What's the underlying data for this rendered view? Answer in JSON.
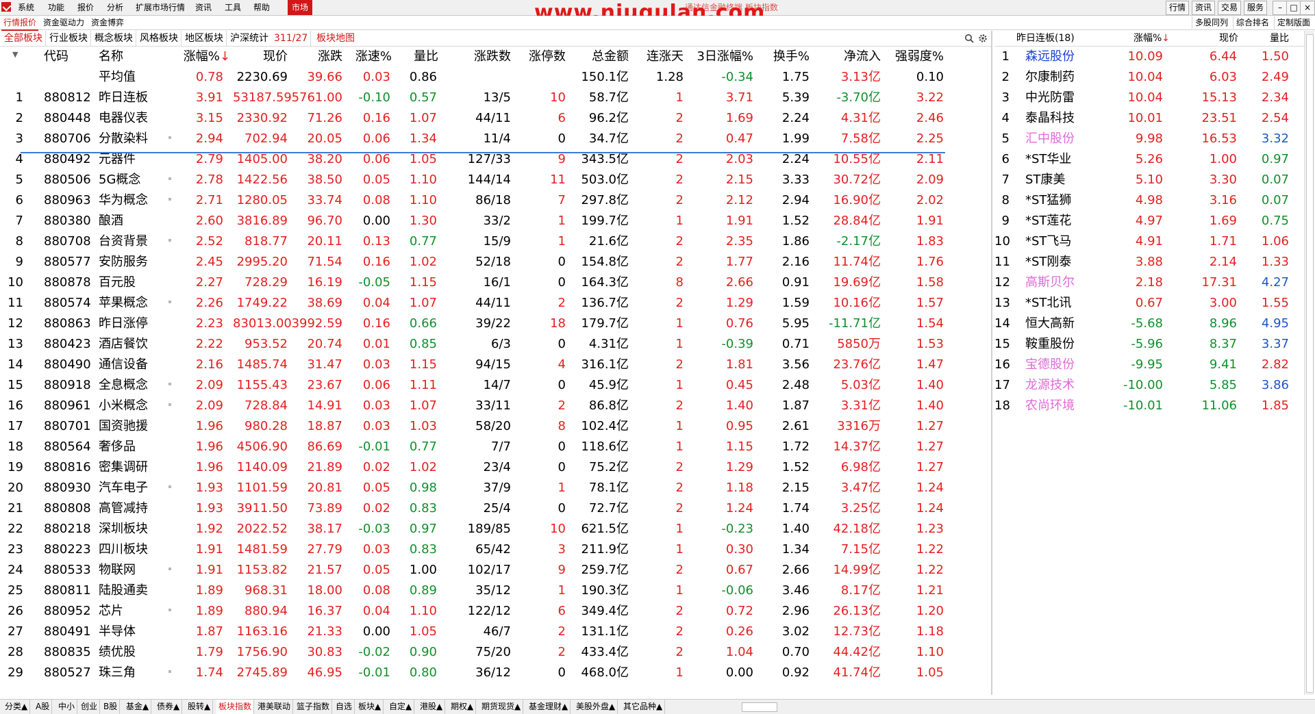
{
  "menubar": {
    "items": [
      "系统",
      "功能",
      "报价",
      "分析",
      "扩展市场行情",
      "资讯",
      "工具",
      "帮助",
      "市场"
    ],
    "watermark": "www.niugulan.com",
    "title_faint": "通达信金融终端  板块指数",
    "right_buttons": [
      "行情",
      "资讯",
      "交易",
      "服务"
    ]
  },
  "subbar": {
    "tabs": [
      "行情报价",
      "资金驱动力",
      "资金博弈"
    ],
    "right": [
      "多股同列",
      "综合排名",
      "定制版面"
    ]
  },
  "tabbar": {
    "tabs": [
      "全部板块",
      "行业板块",
      "概念板块",
      "风格板块",
      "地区板块",
      "沪深统计"
    ],
    "count": "311/27",
    "map": "板块地图"
  },
  "main": {
    "headers": [
      "代码",
      "名称",
      "涨幅%↓",
      "现价",
      "涨跌",
      "涨速%",
      "量比",
      "涨跌数",
      "涨停数",
      "总金额",
      "连涨天",
      "3日涨幅%",
      "换手%",
      "净流入",
      "强弱度%"
    ],
    "avg": {
      "name": "平均值",
      "pct": "0.78",
      "price": "2230.69",
      "chg": "39.66",
      "speed": "0.03",
      "vr": "0.86",
      "amount": "150.1亿",
      "days": "1.28",
      "d3": "-0.34",
      "turn": "1.75",
      "flow": "3.13亿",
      "str": "0.10"
    },
    "rows": [
      {
        "n": "1",
        "code": "880812",
        "name": "昨日连板",
        "dot": false,
        "pct": "3.91",
        "price": "53187.59",
        "chg": "5761.00",
        "speed": "-0.10",
        "vr": "0.57",
        "ud": "13/5",
        "lim": "10",
        "amount": "58.7亿",
        "days": "1",
        "d3": "3.71",
        "turn": "5.39",
        "flow": "-3.70亿",
        "str": "3.22"
      },
      {
        "n": "2",
        "code": "880448",
        "name": "电器仪表",
        "dot": false,
        "pct": "3.15",
        "price": "2330.92",
        "chg": "71.26",
        "speed": "0.16",
        "vr": "1.07",
        "ud": "44/11",
        "lim": "6",
        "amount": "96.2亿",
        "days": "2",
        "d3": "1.69",
        "turn": "2.24",
        "flow": "4.31亿",
        "str": "2.46"
      },
      {
        "n": "3",
        "code": "880706",
        "name": "分散染料",
        "dot": true,
        "pct": "2.94",
        "price": "702.94",
        "chg": "20.05",
        "speed": "0.06",
        "vr": "1.34",
        "ud": "11/4",
        "lim": "0",
        "amount": "34.7亿",
        "days": "2",
        "d3": "0.47",
        "turn": "1.99",
        "flow": "7.58亿",
        "str": "2.25"
      },
      {
        "n": "4",
        "code": "880492",
        "name": "元器件",
        "dot": false,
        "pct": "2.79",
        "price": "1405.00",
        "chg": "38.20",
        "speed": "0.06",
        "vr": "1.05",
        "ud": "127/33",
        "lim": "9",
        "amount": "343.5亿",
        "days": "2",
        "d3": "2.03",
        "turn": "2.24",
        "flow": "10.55亿",
        "str": "2.11"
      },
      {
        "n": "5",
        "code": "880506",
        "name": "5G概念",
        "dot": true,
        "pct": "2.78",
        "price": "1422.56",
        "chg": "38.50",
        "speed": "0.05",
        "vr": "1.10",
        "ud": "144/14",
        "lim": "11",
        "amount": "503.0亿",
        "days": "2",
        "d3": "2.15",
        "turn": "3.33",
        "flow": "30.72亿",
        "str": "2.09"
      },
      {
        "n": "6",
        "code": "880963",
        "name": "华为概念",
        "dot": true,
        "pct": "2.71",
        "price": "1280.05",
        "chg": "33.74",
        "speed": "0.08",
        "vr": "1.10",
        "ud": "86/18",
        "lim": "7",
        "amount": "297.8亿",
        "days": "2",
        "d3": "2.12",
        "turn": "2.94",
        "flow": "16.90亿",
        "str": "2.02"
      },
      {
        "n": "7",
        "code": "880380",
        "name": "酿酒",
        "dot": false,
        "pct": "2.60",
        "price": "3816.89",
        "chg": "96.70",
        "speed": "0.00",
        "vr": "1.30",
        "ud": "33/2",
        "lim": "1",
        "amount": "199.7亿",
        "days": "1",
        "d3": "1.91",
        "turn": "1.52",
        "flow": "28.84亿",
        "str": "1.91"
      },
      {
        "n": "8",
        "code": "880708",
        "name": "台资背景",
        "dot": true,
        "pct": "2.52",
        "price": "818.77",
        "chg": "20.11",
        "speed": "0.13",
        "vr": "0.77",
        "ud": "15/9",
        "lim": "1",
        "amount": "21.6亿",
        "days": "2",
        "d3": "2.35",
        "turn": "1.86",
        "flow": "-2.17亿",
        "str": "1.83"
      },
      {
        "n": "9",
        "code": "880577",
        "name": "安防服务",
        "dot": false,
        "pct": "2.45",
        "price": "2995.20",
        "chg": "71.54",
        "speed": "0.16",
        "vr": "1.02",
        "ud": "52/18",
        "lim": "0",
        "amount": "154.8亿",
        "days": "2",
        "d3": "1.77",
        "turn": "2.16",
        "flow": "11.74亿",
        "str": "1.76"
      },
      {
        "n": "10",
        "code": "880878",
        "name": "百元股",
        "dot": false,
        "pct": "2.27",
        "price": "728.29",
        "chg": "16.19",
        "speed": "-0.05",
        "vr": "1.15",
        "ud": "16/1",
        "lim": "0",
        "amount": "164.3亿",
        "days": "8",
        "d3": "2.66",
        "turn": "0.91",
        "flow": "19.69亿",
        "str": "1.58"
      },
      {
        "n": "11",
        "code": "880574",
        "name": "苹果概念",
        "dot": true,
        "pct": "2.26",
        "price": "1749.22",
        "chg": "38.69",
        "speed": "0.04",
        "vr": "1.07",
        "ud": "44/11",
        "lim": "2",
        "amount": "136.7亿",
        "days": "2",
        "d3": "1.29",
        "turn": "1.59",
        "flow": "10.16亿",
        "str": "1.57"
      },
      {
        "n": "12",
        "code": "880863",
        "name": "昨日涨停",
        "dot": false,
        "pct": "2.23",
        "price": "83013.00",
        "chg": "3992.59",
        "speed": "0.16",
        "vr": "0.66",
        "ud": "39/22",
        "lim": "18",
        "amount": "179.7亿",
        "days": "1",
        "d3": "0.76",
        "turn": "5.95",
        "flow": "-11.71亿",
        "str": "1.54"
      },
      {
        "n": "13",
        "code": "880423",
        "name": "酒店餐饮",
        "dot": false,
        "pct": "2.22",
        "price": "953.52",
        "chg": "20.74",
        "speed": "0.01",
        "vr": "0.85",
        "ud": "6/3",
        "lim": "0",
        "amount": "4.31亿",
        "days": "1",
        "d3": "-0.39",
        "turn": "0.71",
        "flow": "5850万",
        "str": "1.53"
      },
      {
        "n": "14",
        "code": "880490",
        "name": "通信设备",
        "dot": false,
        "pct": "2.16",
        "price": "1485.74",
        "chg": "31.47",
        "speed": "0.03",
        "vr": "1.15",
        "ud": "94/15",
        "lim": "4",
        "amount": "316.1亿",
        "days": "2",
        "d3": "1.81",
        "turn": "3.56",
        "flow": "23.76亿",
        "str": "1.47"
      },
      {
        "n": "15",
        "code": "880918",
        "name": "全息概念",
        "dot": true,
        "pct": "2.09",
        "price": "1155.43",
        "chg": "23.67",
        "speed": "0.06",
        "vr": "1.11",
        "ud": "14/7",
        "lim": "0",
        "amount": "45.9亿",
        "days": "1",
        "d3": "0.45",
        "turn": "2.48",
        "flow": "5.03亿",
        "str": "1.40"
      },
      {
        "n": "16",
        "code": "880961",
        "name": "小米概念",
        "dot": true,
        "pct": "2.09",
        "price": "728.84",
        "chg": "14.91",
        "speed": "0.03",
        "vr": "1.07",
        "ud": "33/11",
        "lim": "2",
        "amount": "86.8亿",
        "days": "2",
        "d3": "1.40",
        "turn": "1.87",
        "flow": "3.31亿",
        "str": "1.40"
      },
      {
        "n": "17",
        "code": "880701",
        "name": "国资驰援",
        "dot": false,
        "pct": "1.96",
        "price": "980.28",
        "chg": "18.87",
        "speed": "0.03",
        "vr": "1.03",
        "ud": "58/20",
        "lim": "8",
        "amount": "102.4亿",
        "days": "1",
        "d3": "0.95",
        "turn": "2.61",
        "flow": "3316万",
        "str": "1.27"
      },
      {
        "n": "18",
        "code": "880564",
        "name": "奢侈品",
        "dot": false,
        "pct": "1.96",
        "price": "4506.90",
        "chg": "86.69",
        "speed": "-0.01",
        "vr": "0.77",
        "ud": "7/7",
        "lim": "0",
        "amount": "118.6亿",
        "days": "1",
        "d3": "1.15",
        "turn": "1.72",
        "flow": "14.37亿",
        "str": "1.27"
      },
      {
        "n": "19",
        "code": "880816",
        "name": "密集调研",
        "dot": false,
        "pct": "1.96",
        "price": "1140.09",
        "chg": "21.89",
        "speed": "0.02",
        "vr": "1.02",
        "ud": "23/4",
        "lim": "0",
        "amount": "75.2亿",
        "days": "2",
        "d3": "1.29",
        "turn": "1.52",
        "flow": "6.98亿",
        "str": "1.27"
      },
      {
        "n": "20",
        "code": "880930",
        "name": "汽车电子",
        "dot": true,
        "pct": "1.93",
        "price": "1101.59",
        "chg": "20.81",
        "speed": "0.05",
        "vr": "0.98",
        "ud": "37/9",
        "lim": "1",
        "amount": "78.1亿",
        "days": "2",
        "d3": "1.18",
        "turn": "2.15",
        "flow": "3.47亿",
        "str": "1.24"
      },
      {
        "n": "21",
        "code": "880808",
        "name": "高管减持",
        "dot": false,
        "pct": "1.93",
        "price": "3911.50",
        "chg": "73.89",
        "speed": "0.02",
        "vr": "0.83",
        "ud": "25/4",
        "lim": "0",
        "amount": "72.7亿",
        "days": "2",
        "d3": "1.24",
        "turn": "1.74",
        "flow": "3.25亿",
        "str": "1.24"
      },
      {
        "n": "22",
        "code": "880218",
        "name": "深圳板块",
        "dot": false,
        "pct": "1.92",
        "price": "2022.52",
        "chg": "38.17",
        "speed": "-0.03",
        "vr": "0.97",
        "ud": "189/85",
        "lim": "10",
        "amount": "621.5亿",
        "days": "1",
        "d3": "-0.23",
        "turn": "1.40",
        "flow": "42.18亿",
        "str": "1.23"
      },
      {
        "n": "23",
        "code": "880223",
        "name": "四川板块",
        "dot": false,
        "pct": "1.91",
        "price": "1481.59",
        "chg": "27.79",
        "speed": "0.03",
        "vr": "0.83",
        "ud": "65/42",
        "lim": "3",
        "amount": "211.9亿",
        "days": "1",
        "d3": "0.30",
        "turn": "1.34",
        "flow": "7.15亿",
        "str": "1.22"
      },
      {
        "n": "24",
        "code": "880533",
        "name": "物联网",
        "dot": true,
        "pct": "1.91",
        "price": "1153.82",
        "chg": "21.57",
        "speed": "0.05",
        "vr": "1.00",
        "ud": "102/17",
        "lim": "9",
        "amount": "259.7亿",
        "days": "2",
        "d3": "0.67",
        "turn": "2.66",
        "flow": "14.99亿",
        "str": "1.22"
      },
      {
        "n": "25",
        "code": "880811",
        "name": "陆股通卖",
        "dot": false,
        "pct": "1.89",
        "price": "968.31",
        "chg": "18.00",
        "speed": "0.08",
        "vr": "0.89",
        "ud": "35/12",
        "lim": "1",
        "amount": "190.3亿",
        "days": "1",
        "d3": "-0.06",
        "turn": "3.46",
        "flow": "8.17亿",
        "str": "1.21"
      },
      {
        "n": "26",
        "code": "880952",
        "name": "芯片",
        "dot": true,
        "pct": "1.89",
        "price": "880.94",
        "chg": "16.37",
        "speed": "0.04",
        "vr": "1.10",
        "ud": "122/12",
        "lim": "6",
        "amount": "349.4亿",
        "days": "2",
        "d3": "0.72",
        "turn": "2.96",
        "flow": "26.13亿",
        "str": "1.20"
      },
      {
        "n": "27",
        "code": "880491",
        "name": "半导体",
        "dot": false,
        "pct": "1.87",
        "price": "1163.16",
        "chg": "21.33",
        "speed": "0.00",
        "vr": "1.05",
        "ud": "46/7",
        "lim": "2",
        "amount": "131.1亿",
        "days": "2",
        "d3": "0.26",
        "turn": "3.02",
        "flow": "12.73亿",
        "str": "1.18"
      },
      {
        "n": "28",
        "code": "880835",
        "name": "绩优股",
        "dot": false,
        "pct": "1.79",
        "price": "1756.90",
        "chg": "30.83",
        "speed": "-0.02",
        "vr": "0.90",
        "ud": "75/20",
        "lim": "2",
        "amount": "433.4亿",
        "days": "2",
        "d3": "1.04",
        "turn": "0.70",
        "flow": "44.42亿",
        "str": "1.10"
      },
      {
        "n": "29",
        "code": "880527",
        "name": "珠三角",
        "dot": true,
        "pct": "1.74",
        "price": "2745.89",
        "chg": "46.95",
        "speed": "-0.01",
        "vr": "0.80",
        "ud": "36/12",
        "lim": "0",
        "amount": "468.0亿",
        "days": "1",
        "d3": "0.00",
        "turn": "0.92",
        "flow": "41.74亿",
        "str": "1.05"
      }
    ]
  },
  "right_panel": {
    "title": "昨日连板(18)",
    "headers": [
      "涨幅%↓",
      "现价",
      "量比"
    ],
    "rows": [
      {
        "n": "1",
        "name": "森远股份",
        "color": "blue",
        "pct": "10.09",
        "price": "6.44",
        "vr": "1.50"
      },
      {
        "n": "2",
        "name": "尔康制药",
        "color": "black",
        "pct": "10.04",
        "price": "6.03",
        "vr": "2.49"
      },
      {
        "n": "3",
        "name": "中光防雷",
        "color": "black",
        "pct": "10.04",
        "price": "15.13",
        "vr": "2.34"
      },
      {
        "n": "4",
        "name": "泰晶科技",
        "color": "black",
        "pct": "10.01",
        "price": "23.51",
        "vr": "2.54"
      },
      {
        "n": "5",
        "name": "汇中股份",
        "color": "pink",
        "pct": "9.98",
        "price": "16.53",
        "vr": "3.32"
      },
      {
        "n": "6",
        "name": "*ST华业",
        "color": "black",
        "pct": "5.26",
        "price": "1.00",
        "vr": "0.97"
      },
      {
        "n": "7",
        "name": "ST康美",
        "color": "black",
        "pct": "5.10",
        "price": "3.30",
        "vr": "0.07"
      },
      {
        "n": "8",
        "name": "*ST猛狮",
        "color": "black",
        "pct": "4.98",
        "price": "3.16",
        "vr": "0.07"
      },
      {
        "n": "9",
        "name": "*ST莲花",
        "color": "black",
        "pct": "4.97",
        "price": "1.69",
        "vr": "0.75"
      },
      {
        "n": "10",
        "name": "*ST飞马",
        "color": "black",
        "pct": "4.91",
        "price": "1.71",
        "vr": "1.06"
      },
      {
        "n": "11",
        "name": "*ST刚泰",
        "color": "black",
        "pct": "3.88",
        "price": "2.14",
        "vr": "1.33"
      },
      {
        "n": "12",
        "name": "高斯贝尔",
        "color": "pink",
        "pct": "2.18",
        "price": "17.31",
        "vr": "4.27"
      },
      {
        "n": "13",
        "name": "*ST北讯",
        "color": "black",
        "pct": "0.67",
        "price": "3.00",
        "vr": "1.55"
      },
      {
        "n": "14",
        "name": "恒大高新",
        "color": "black",
        "pct": "-5.68",
        "price": "8.96",
        "vr": "4.95"
      },
      {
        "n": "15",
        "name": "鞍重股份",
        "color": "black",
        "pct": "-5.96",
        "price": "8.37",
        "vr": "3.37"
      },
      {
        "n": "16",
        "name": "宝德股份",
        "color": "pink",
        "pct": "-9.95",
        "price": "9.41",
        "vr": "2.82"
      },
      {
        "n": "17",
        "name": "龙源技术",
        "color": "pink",
        "pct": "-10.00",
        "price": "5.85",
        "vr": "3.86"
      },
      {
        "n": "18",
        "name": "农尚环境",
        "color": "pink",
        "pct": "-10.01",
        "price": "11.06",
        "vr": "1.85"
      }
    ]
  },
  "bottombar": {
    "tabs": [
      "分类▲",
      "A股",
      "中小",
      "创业",
      "B股",
      "基金▲",
      "债券▲",
      "股转▲",
      "板块指数",
      "港美联动",
      "篮子指数",
      "自选",
      "板块▲",
      "自定▲",
      "港股▲",
      "期权▲",
      "期货现货▲",
      "基金理财▲",
      "美股外盘▲",
      "其它品种▲"
    ],
    "active": "板块指数"
  },
  "colors": {
    "up": "#e51f1f",
    "down": "#10902b",
    "accent": "#d01818",
    "selection": "#3a7bd5"
  }
}
